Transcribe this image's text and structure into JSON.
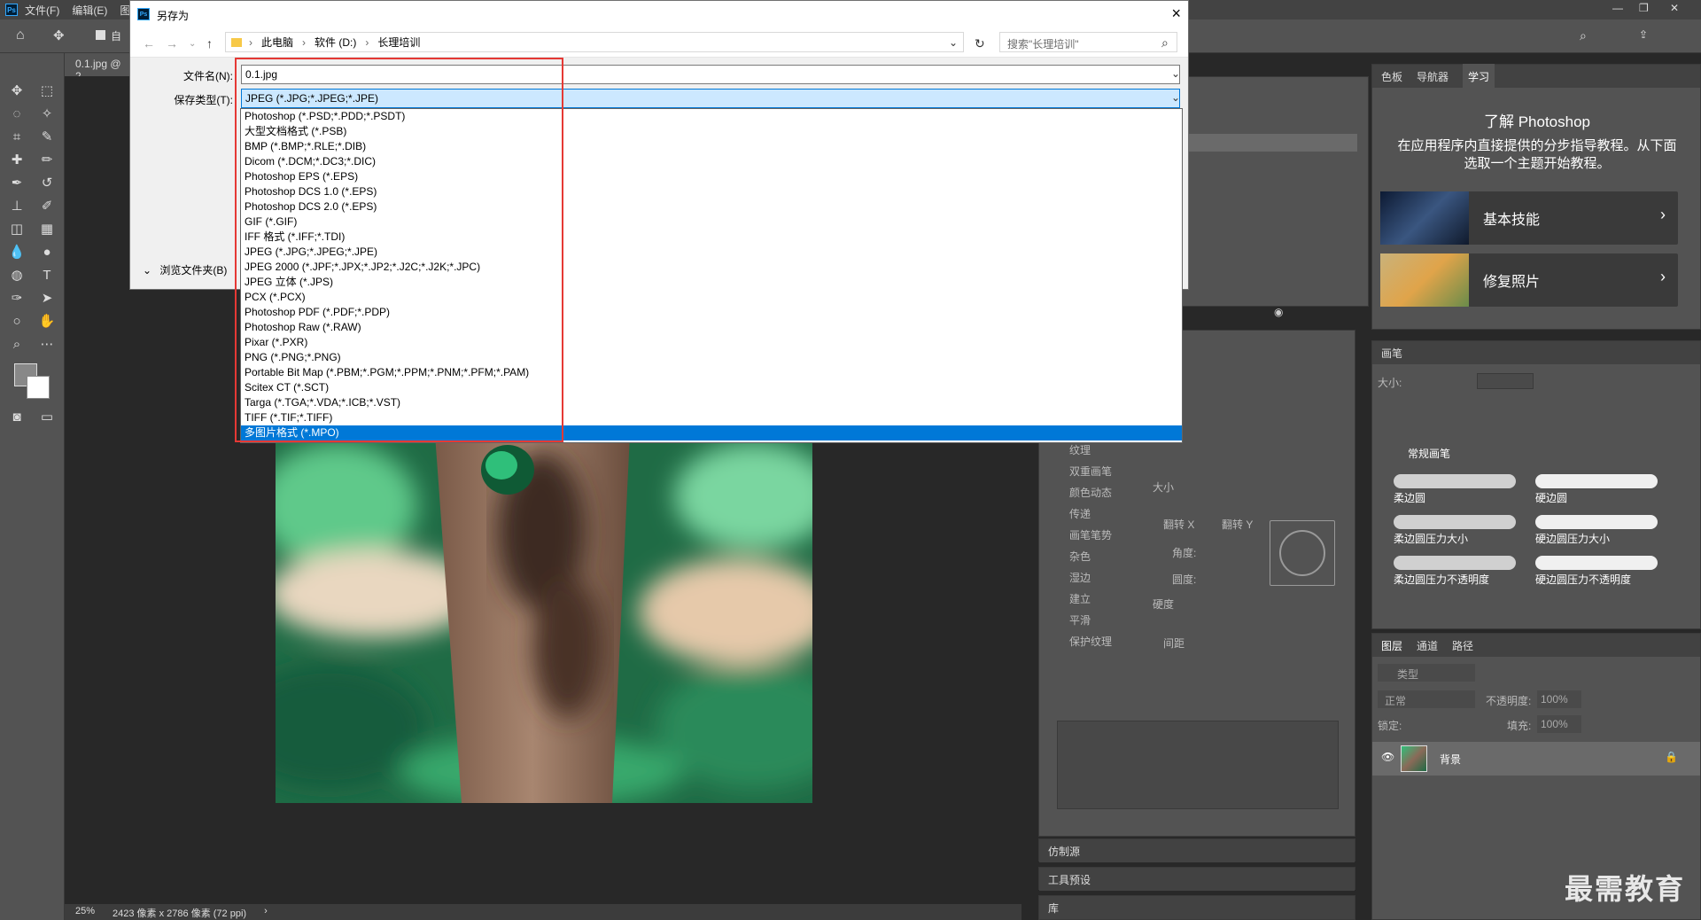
{
  "ps": {
    "menus": [
      "文件(F)",
      "编辑(E)",
      "图"
    ],
    "options_auto_label": "自",
    "doc_tab": "0.1.jpg @ 2",
    "status": {
      "zoom": "25%",
      "size": "2423 像素 x 2786 像素 (72 ppi)",
      "arrow": "›"
    }
  },
  "dialog": {
    "title": "另存为",
    "close_glyph": "×",
    "path": [
      "此电脑",
      "软件 (D:)",
      "长理培训"
    ],
    "search_placeholder": "搜索\"长理培训\"",
    "filename_label": "文件名(N):",
    "filename_value": "0.1.jpg",
    "filetype_label": "保存类型(T):",
    "filetype_value": "JPEG (*.JPG;*.JPEG;*.JPE)",
    "browse_label": "浏览文件夹(B)",
    "filetypes": [
      "Photoshop (*.PSD;*.PDD;*.PSDT)",
      "大型文档格式 (*.PSB)",
      "BMP (*.BMP;*.RLE;*.DIB)",
      "Dicom (*.DCM;*.DC3;*.DIC)",
      "Photoshop EPS (*.EPS)",
      "Photoshop DCS 1.0 (*.EPS)",
      "Photoshop DCS 2.0 (*.EPS)",
      "GIF (*.GIF)",
      "IFF 格式 (*.IFF;*.TDI)",
      "JPEG (*.JPG;*.JPEG;*.JPE)",
      "JPEG 2000 (*.JPF;*.JPX;*.JP2;*.J2C;*.J2K;*.JPC)",
      "JPEG 立体 (*.JPS)",
      "PCX (*.PCX)",
      "Photoshop PDF (*.PDF;*.PDP)",
      "Photoshop Raw (*.RAW)",
      "Pixar (*.PXR)",
      "PNG (*.PNG;*.PNG)",
      "Portable Bit Map (*.PBM;*.PGM;*.PPM;*.PNM;*.PFM;*.PAM)",
      "Scitex CT (*.SCT)",
      "Targa (*.TGA;*.VDA;*.ICB;*.VST)",
      "TIFF (*.TIF;*.TIFF)",
      "多图片格式 (*.MPO)"
    ],
    "selected_index": 21
  },
  "right": {
    "top_tabs": [
      "色板",
      "导航器",
      "学习"
    ],
    "learn_title": "了解 Photoshop",
    "learn_desc": "在应用程序内直接提供的分步指导教程。从下面选取一个主题开始教程。",
    "cards": [
      "基本技能",
      "修复照片"
    ],
    "brush_panel": "画笔",
    "brush_size_label": "大小:",
    "brush_group": "常规画笔",
    "brushes": [
      "柔边圆",
      "硬边圆",
      "柔边圆压力大小",
      "硬边圆压力大小",
      "柔边圆压力不透明度",
      "硬边圆压力不透明度"
    ],
    "layer_tabs": [
      "图层",
      "通道",
      "路径"
    ],
    "layer_kind": "类型",
    "blend_mode": "正常",
    "opacity_label": "不透明度:",
    "opacity_value": "100%",
    "lock_label": "锁定:",
    "fill_label": "填充:",
    "fill_value": "100%",
    "layer_name": "背景"
  },
  "mid": {
    "brush_settings": [
      "纹理",
      "双重画笔",
      "颜色动态",
      "传递",
      "画笔笔势",
      "杂色",
      "湿边",
      "建立",
      "平滑",
      "保护纹理"
    ],
    "size_label": "大小",
    "flip_x": "翻转 X",
    "flip_y": "翻转 Y",
    "angle_label": "角度:",
    "roundness_label": "圆度:",
    "hardness_label": "硬度",
    "spacing_label": "间距",
    "clone_source": "仿制源",
    "tool_presets": "工具预设",
    "library": "库"
  },
  "watermark": "最需教育"
}
